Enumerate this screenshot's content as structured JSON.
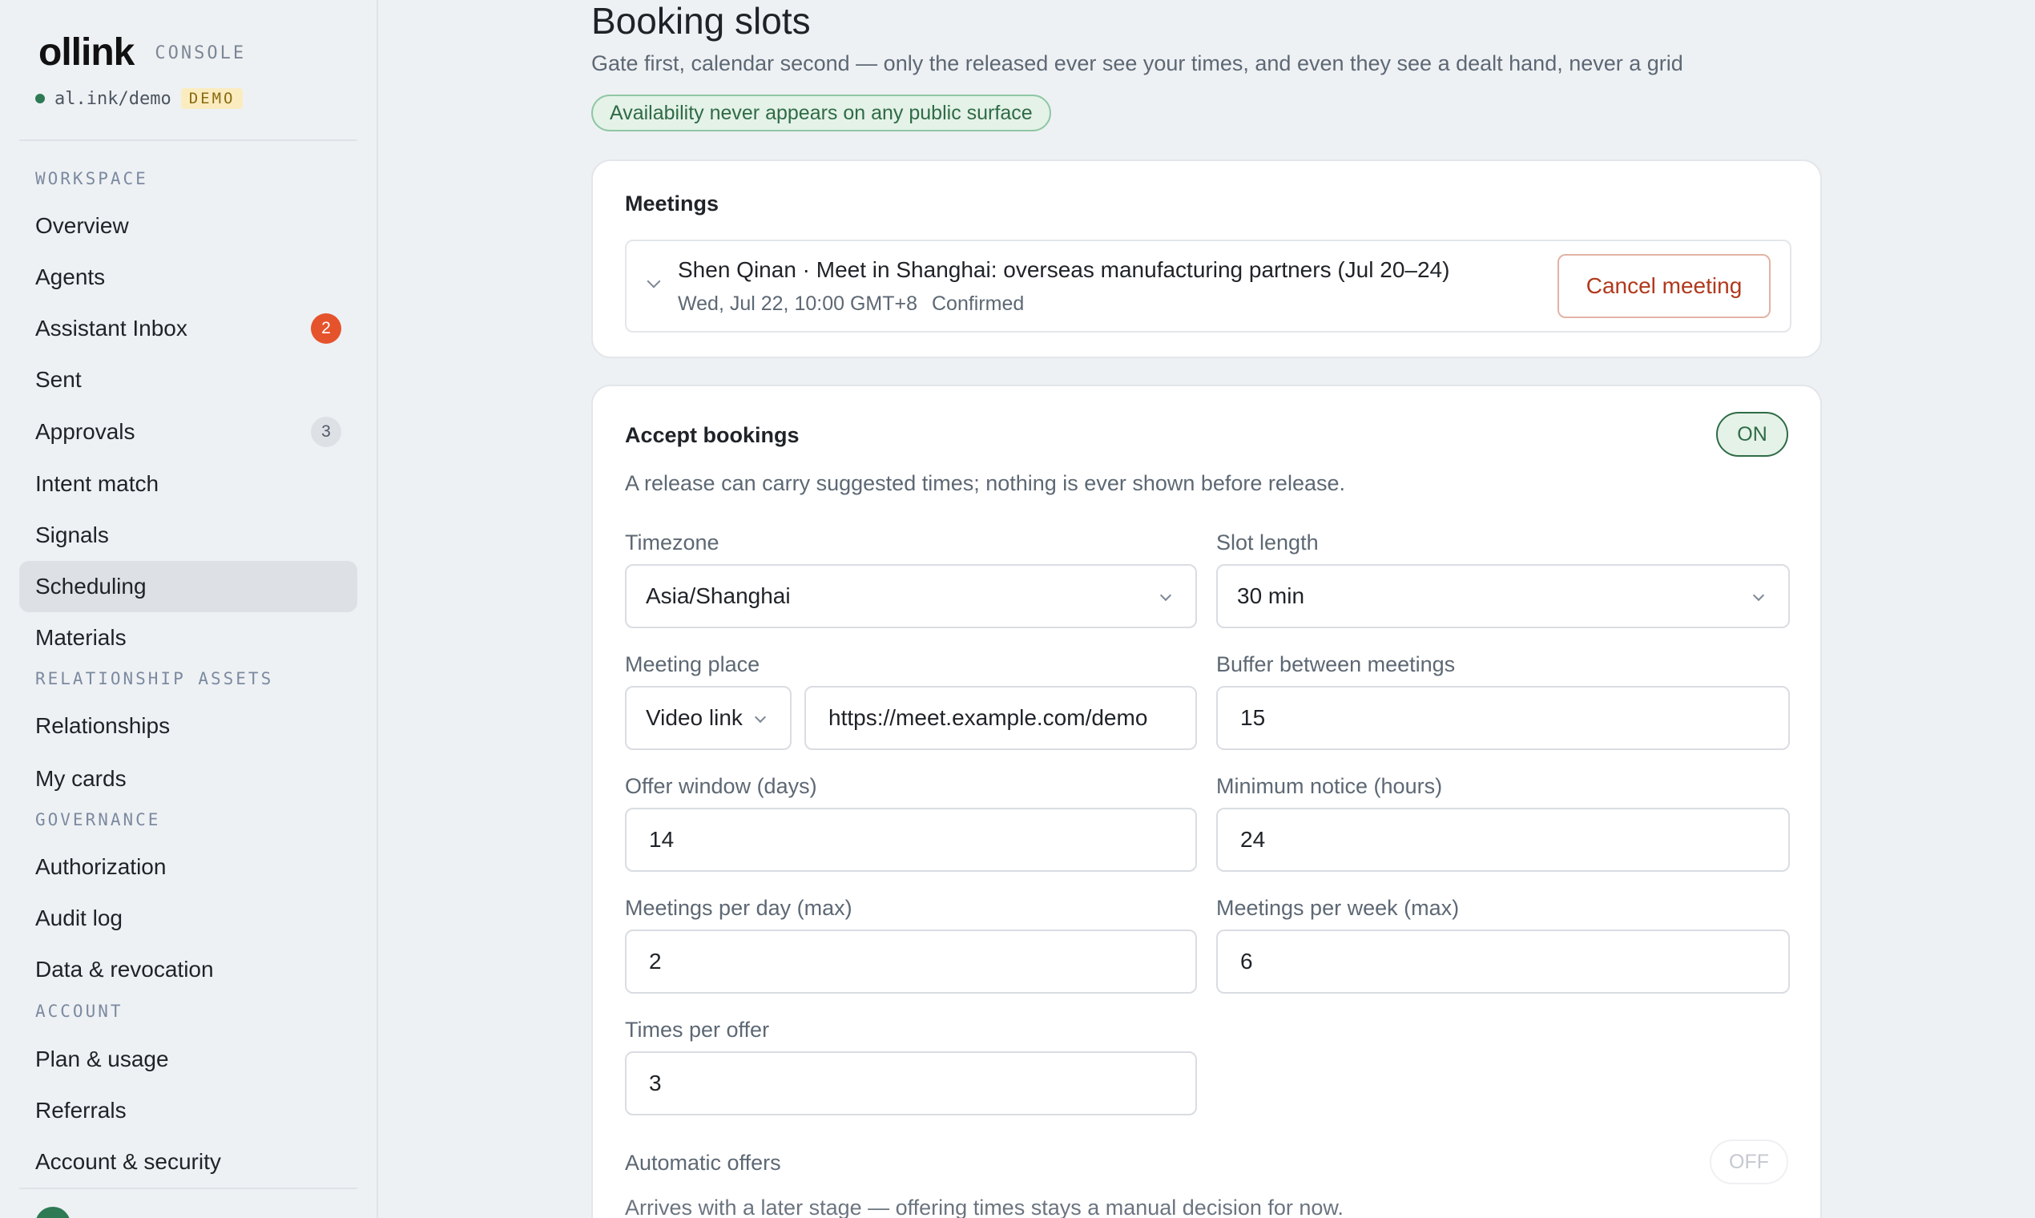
{
  "brand": {
    "logo": "ollink",
    "console_label": "CONSOLE",
    "org_url": "al.ink/demo",
    "org_badge": "DEMO"
  },
  "sidebar": {
    "sections": {
      "workspace": "WORKSPACE",
      "relationship_assets": "RELATIONSHIP ASSETS",
      "governance": "GOVERNANCE",
      "account": "ACCOUNT"
    },
    "items": {
      "overview": "Overview",
      "agents": "Agents",
      "assistant_inbox": "Assistant Inbox",
      "assistant_inbox_count": "2",
      "sent": "Sent",
      "approvals": "Approvals",
      "approvals_count": "3",
      "intent_match": "Intent match",
      "signals": "Signals",
      "scheduling": "Scheduling",
      "materials": "Materials",
      "relationships": "Relationships",
      "my_cards": "My cards",
      "authorization": "Authorization",
      "audit_log": "Audit log",
      "data_revocation": "Data & revocation",
      "plan_usage": "Plan & usage",
      "referrals": "Referrals",
      "account_security": "Account & security"
    },
    "active_item": "Scheduling"
  },
  "header": {
    "title": "Booking slots",
    "subtitle": "Gate first, calendar second — only the released ever see your times, and even they see a dealt hand, never a grid",
    "notice": "Availability never appears on any public surface"
  },
  "meetings": {
    "title": "Meetings",
    "item": {
      "title": "Shen Qinan · Meet in Shanghai: overseas manufacturing partners (Jul 20–24)",
      "when": "Wed, Jul 22, 10:00 GMT+8",
      "status": "Confirmed",
      "cancel_label": "Cancel meeting"
    }
  },
  "bookings": {
    "title": "Accept bookings",
    "toggle": "ON",
    "description": "A release can carry suggested times; nothing is ever shown before release.",
    "timezone_label": "Timezone",
    "timezone_value": "Asia/Shanghai",
    "slot_length_label": "Slot length",
    "slot_length_value": "30 min",
    "meeting_place_label": "Meeting place",
    "meeting_place_type": "Video link",
    "meeting_place_url": "https://meet.example.com/demo",
    "buffer_label": "Buffer between meetings",
    "buffer_value": "15",
    "offer_window_label": "Offer window (days)",
    "offer_window_value": "14",
    "min_notice_label": "Minimum notice (hours)",
    "min_notice_value": "24",
    "per_day_label": "Meetings per day (max)",
    "per_day_value": "2",
    "per_week_label": "Meetings per week (max)",
    "per_week_value": "6",
    "times_per_offer_label": "Times per offer",
    "times_per_offer_value": "3",
    "automatic_offers_title": "Automatic offers",
    "automatic_offers_toggle": "OFF",
    "automatic_offers_desc": "Arrives with a later stage — offering times stays a manual decision for now."
  },
  "colors": {
    "accent_green": "#2f6b45",
    "badge_red": "#e5532c",
    "cancel_red": "#b0391c"
  }
}
